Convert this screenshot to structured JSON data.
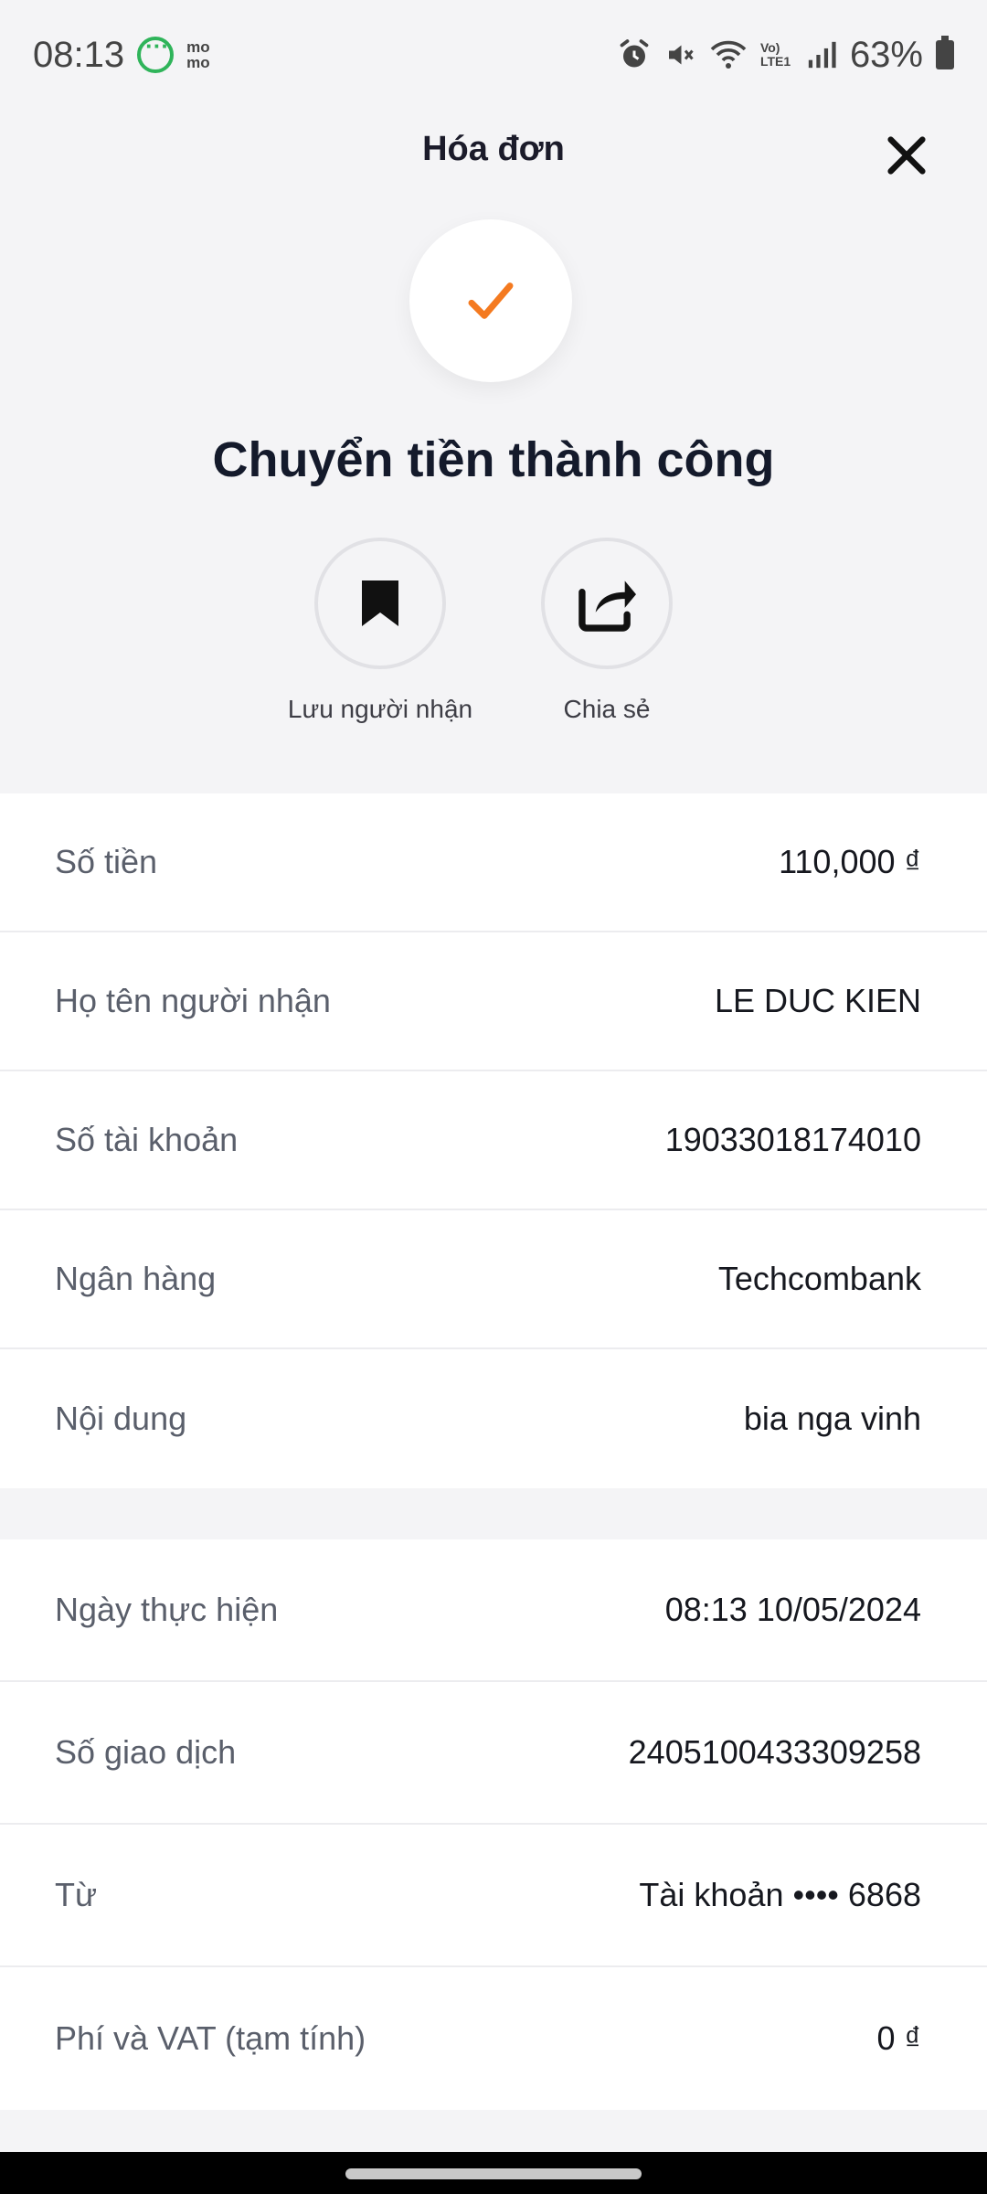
{
  "status_bar": {
    "time": "08:13",
    "momo_text": "mo mo",
    "volte_text": "Vo) LTE1",
    "battery": "63%"
  },
  "header": {
    "title": "Hóa đơn"
  },
  "success": {
    "title": "Chuyển tiền thành công",
    "accent_color": "#f47a20"
  },
  "actions": {
    "save_label": "Lưu người nhận",
    "share_label": "Chia sẻ"
  },
  "details": [
    {
      "label": "Số tiền",
      "value": "110,000 ₫"
    },
    {
      "label": "Họ tên người nhận",
      "value": "LE DUC KIEN"
    },
    {
      "label": "Số tài khoản",
      "value": "19033018174010"
    },
    {
      "label": "Ngân hàng",
      "value": "Techcombank"
    },
    {
      "label": "Nội dung",
      "value": "bia nga vinh"
    }
  ],
  "transaction": [
    {
      "label": "Ngày thực hiện",
      "value": "08:13 10/05/2024"
    },
    {
      "label": "Số giao dịch",
      "value": "2405100433309258"
    },
    {
      "label": "Từ",
      "value": "Tài khoản •••• 6868"
    },
    {
      "label": "Phí và VAT (tạm tính)",
      "value": "0 ₫"
    }
  ]
}
